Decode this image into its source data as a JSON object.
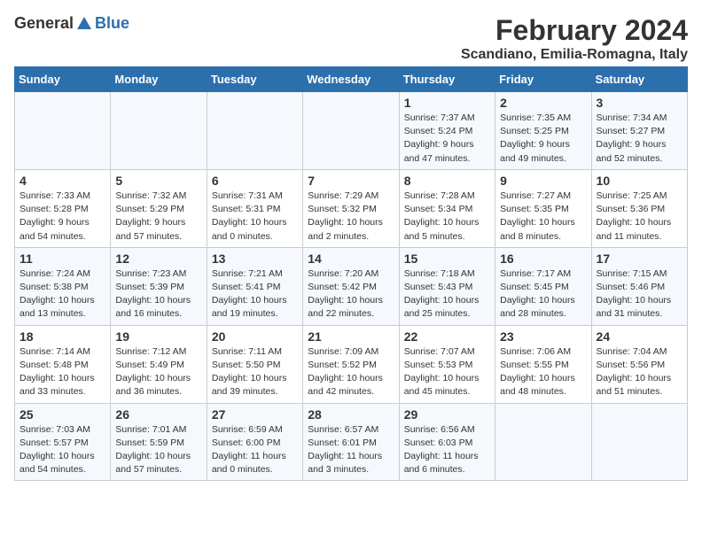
{
  "header": {
    "logo_general": "General",
    "logo_blue": "Blue",
    "month_title": "February 2024",
    "location": "Scandiano, Emilia-Romagna, Italy"
  },
  "days_of_week": [
    "Sunday",
    "Monday",
    "Tuesday",
    "Wednesday",
    "Thursday",
    "Friday",
    "Saturday"
  ],
  "weeks": [
    [
      {
        "day": "",
        "info": ""
      },
      {
        "day": "",
        "info": ""
      },
      {
        "day": "",
        "info": ""
      },
      {
        "day": "",
        "info": ""
      },
      {
        "day": "1",
        "info": "Sunrise: 7:37 AM\nSunset: 5:24 PM\nDaylight: 9 hours\nand 47 minutes."
      },
      {
        "day": "2",
        "info": "Sunrise: 7:35 AM\nSunset: 5:25 PM\nDaylight: 9 hours\nand 49 minutes."
      },
      {
        "day": "3",
        "info": "Sunrise: 7:34 AM\nSunset: 5:27 PM\nDaylight: 9 hours\nand 52 minutes."
      }
    ],
    [
      {
        "day": "4",
        "info": "Sunrise: 7:33 AM\nSunset: 5:28 PM\nDaylight: 9 hours\nand 54 minutes."
      },
      {
        "day": "5",
        "info": "Sunrise: 7:32 AM\nSunset: 5:29 PM\nDaylight: 9 hours\nand 57 minutes."
      },
      {
        "day": "6",
        "info": "Sunrise: 7:31 AM\nSunset: 5:31 PM\nDaylight: 10 hours\nand 0 minutes."
      },
      {
        "day": "7",
        "info": "Sunrise: 7:29 AM\nSunset: 5:32 PM\nDaylight: 10 hours\nand 2 minutes."
      },
      {
        "day": "8",
        "info": "Sunrise: 7:28 AM\nSunset: 5:34 PM\nDaylight: 10 hours\nand 5 minutes."
      },
      {
        "day": "9",
        "info": "Sunrise: 7:27 AM\nSunset: 5:35 PM\nDaylight: 10 hours\nand 8 minutes."
      },
      {
        "day": "10",
        "info": "Sunrise: 7:25 AM\nSunset: 5:36 PM\nDaylight: 10 hours\nand 11 minutes."
      }
    ],
    [
      {
        "day": "11",
        "info": "Sunrise: 7:24 AM\nSunset: 5:38 PM\nDaylight: 10 hours\nand 13 minutes."
      },
      {
        "day": "12",
        "info": "Sunrise: 7:23 AM\nSunset: 5:39 PM\nDaylight: 10 hours\nand 16 minutes."
      },
      {
        "day": "13",
        "info": "Sunrise: 7:21 AM\nSunset: 5:41 PM\nDaylight: 10 hours\nand 19 minutes."
      },
      {
        "day": "14",
        "info": "Sunrise: 7:20 AM\nSunset: 5:42 PM\nDaylight: 10 hours\nand 22 minutes."
      },
      {
        "day": "15",
        "info": "Sunrise: 7:18 AM\nSunset: 5:43 PM\nDaylight: 10 hours\nand 25 minutes."
      },
      {
        "day": "16",
        "info": "Sunrise: 7:17 AM\nSunset: 5:45 PM\nDaylight: 10 hours\nand 28 minutes."
      },
      {
        "day": "17",
        "info": "Sunrise: 7:15 AM\nSunset: 5:46 PM\nDaylight: 10 hours\nand 31 minutes."
      }
    ],
    [
      {
        "day": "18",
        "info": "Sunrise: 7:14 AM\nSunset: 5:48 PM\nDaylight: 10 hours\nand 33 minutes."
      },
      {
        "day": "19",
        "info": "Sunrise: 7:12 AM\nSunset: 5:49 PM\nDaylight: 10 hours\nand 36 minutes."
      },
      {
        "day": "20",
        "info": "Sunrise: 7:11 AM\nSunset: 5:50 PM\nDaylight: 10 hours\nand 39 minutes."
      },
      {
        "day": "21",
        "info": "Sunrise: 7:09 AM\nSunset: 5:52 PM\nDaylight: 10 hours\nand 42 minutes."
      },
      {
        "day": "22",
        "info": "Sunrise: 7:07 AM\nSunset: 5:53 PM\nDaylight: 10 hours\nand 45 minutes."
      },
      {
        "day": "23",
        "info": "Sunrise: 7:06 AM\nSunset: 5:55 PM\nDaylight: 10 hours\nand 48 minutes."
      },
      {
        "day": "24",
        "info": "Sunrise: 7:04 AM\nSunset: 5:56 PM\nDaylight: 10 hours\nand 51 minutes."
      }
    ],
    [
      {
        "day": "25",
        "info": "Sunrise: 7:03 AM\nSunset: 5:57 PM\nDaylight: 10 hours\nand 54 minutes."
      },
      {
        "day": "26",
        "info": "Sunrise: 7:01 AM\nSunset: 5:59 PM\nDaylight: 10 hours\nand 57 minutes."
      },
      {
        "day": "27",
        "info": "Sunrise: 6:59 AM\nSunset: 6:00 PM\nDaylight: 11 hours\nand 0 minutes."
      },
      {
        "day": "28",
        "info": "Sunrise: 6:57 AM\nSunset: 6:01 PM\nDaylight: 11 hours\nand 3 minutes."
      },
      {
        "day": "29",
        "info": "Sunrise: 6:56 AM\nSunset: 6:03 PM\nDaylight: 11 hours\nand 6 minutes."
      },
      {
        "day": "",
        "info": ""
      },
      {
        "day": "",
        "info": ""
      }
    ]
  ]
}
